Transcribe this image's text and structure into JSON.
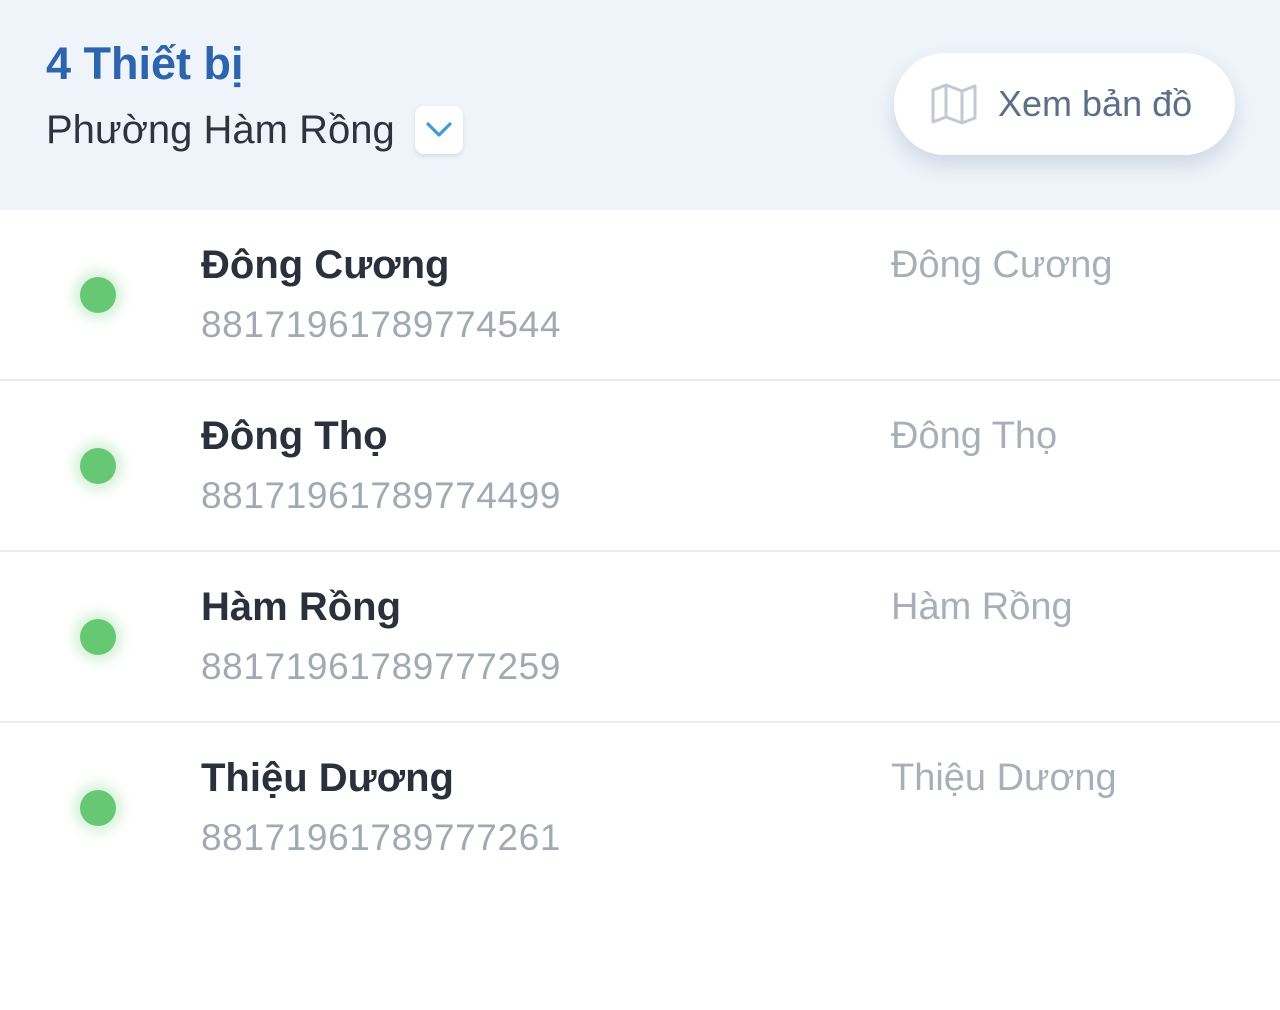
{
  "header": {
    "device_count_label": "4 Thiết bị",
    "ward_name": "Phường Hàm Rồng",
    "dropdown_icon": "chevron-down-icon",
    "map_button": {
      "icon": "map-icon",
      "label": "Xem bản đồ"
    }
  },
  "devices": [
    {
      "name": "Đông Cương",
      "id": "88171961789774544",
      "location": "Đông Cương",
      "status": "online"
    },
    {
      "name": "Đông Thọ",
      "id": "88171961789774499",
      "location": "Đông Thọ",
      "status": "online"
    },
    {
      "name": "Hàm Rồng",
      "id": "88171961789777259",
      "location": "Hàm Rồng",
      "status": "online"
    },
    {
      "name": "Thiệu Dương",
      "id": "88171961789777261",
      "location": "Thiệu Dương",
      "status": "online"
    }
  ],
  "colors": {
    "header_background": "#eff4fa",
    "accent_blue": "#2c64ad",
    "status_online": "#67c873",
    "chevron_blue": "#3a9fd8"
  }
}
